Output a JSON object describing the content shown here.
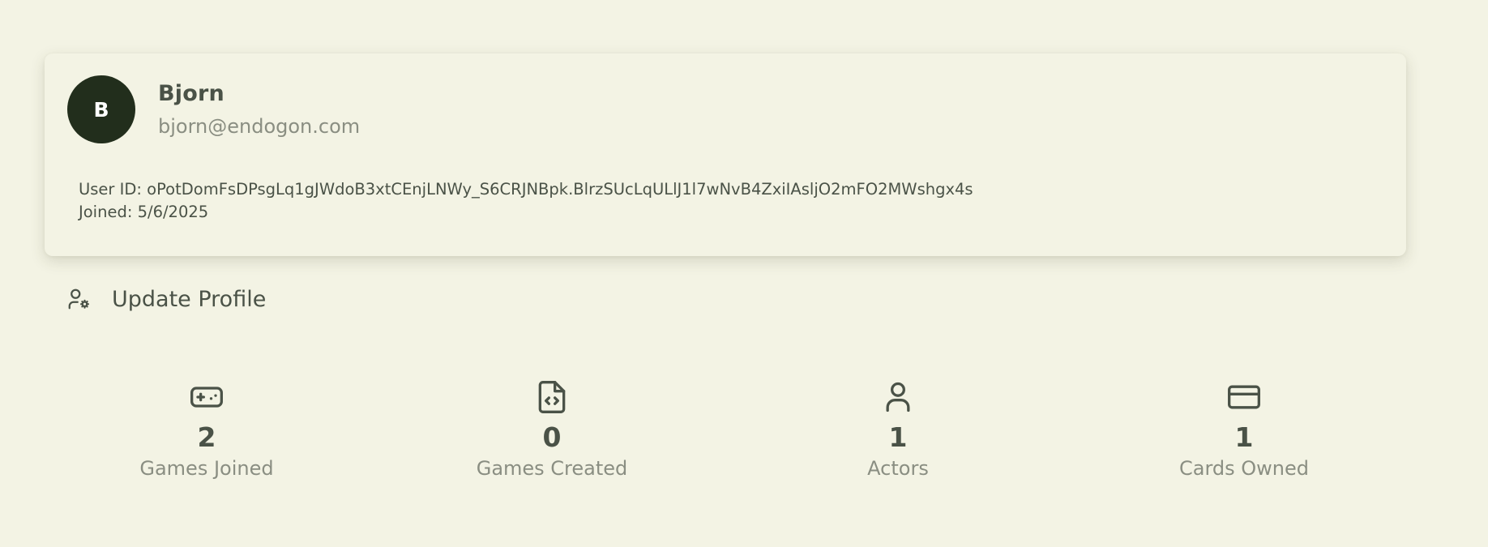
{
  "profile": {
    "avatar_initial": "B",
    "name": "Bjorn",
    "email": "bjorn@endogon.com",
    "user_id_line": "User ID: oPotDomFsDPsgLq1gJWdoB3xtCEnjLNWy_S6CRJNBpk.BlrzSUcLqULlJ1l7wNvB4ZxiIAsljO2mFO2MWshgx4s",
    "joined_line": "Joined: 5/6/2025"
  },
  "actions": {
    "update_profile_label": "Update Profile",
    "update_profile_icon": "user-gear-icon"
  },
  "stats": [
    {
      "icon": "gamepad-icon",
      "value": "2",
      "label": "Games Joined"
    },
    {
      "icon": "file-code-icon",
      "value": "0",
      "label": "Games Created"
    },
    {
      "icon": "user-icon",
      "value": "1",
      "label": "Actors"
    },
    {
      "icon": "credit-card-icon",
      "value": "1",
      "label": "Cards Owned"
    }
  ],
  "colors": {
    "background": "#f3f3e4",
    "avatar_bg": "#222e1c",
    "text_primary": "#4a5247",
    "text_muted": "#8a8e82"
  }
}
